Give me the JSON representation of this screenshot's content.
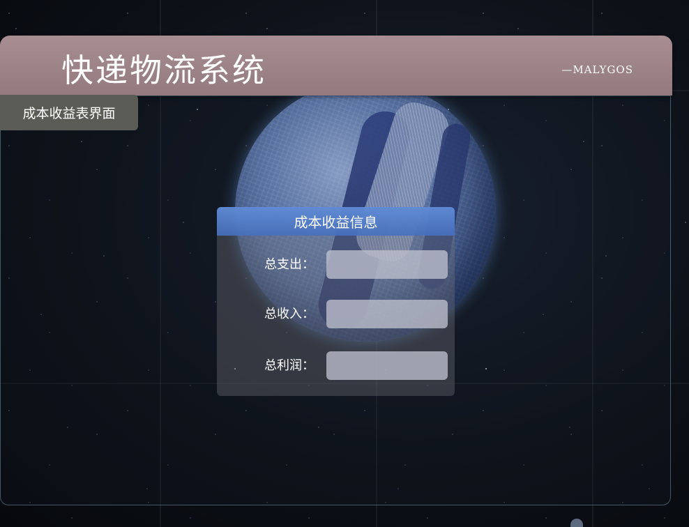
{
  "header": {
    "title": "快递物流系统",
    "signature": "—MALYGOS"
  },
  "page_label": "成本收益表界面",
  "info_card": {
    "title": "成本收益信息",
    "fields": [
      {
        "label": "总支出：",
        "value": ""
      },
      {
        "label": "总收入：",
        "value": ""
      },
      {
        "label": "总利润：",
        "value": ""
      }
    ]
  },
  "colors": {
    "header_bg": "#a88e92",
    "page_label_bg": "#5c5c56",
    "card_header_bg": "#5f8cd7"
  }
}
